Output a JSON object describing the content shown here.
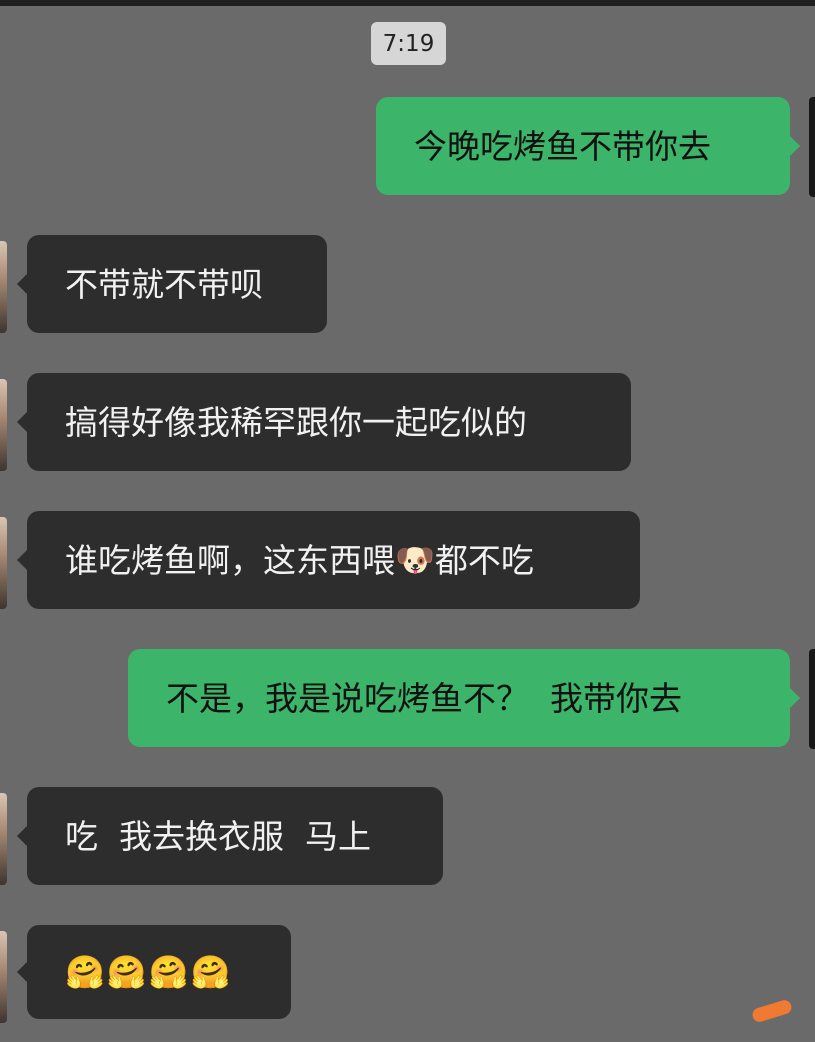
{
  "chat": {
    "time": "7:19",
    "messages": [
      {
        "side": "out",
        "text": "今晚吃烤鱼不带你去"
      },
      {
        "side": "in",
        "text": "不带就不带呗"
      },
      {
        "side": "in",
        "text": "搞得好像我稀罕跟你一起吃似的"
      },
      {
        "side": "in",
        "text_before": "谁吃烤鱼啊，这东西喂",
        "emoji": "🐶",
        "text_after": "都不吃"
      },
      {
        "side": "out",
        "text": "不是，我是说吃烤鱼不？  我带你去"
      },
      {
        "side": "in",
        "text": "吃  我去换衣服  马上"
      },
      {
        "side": "in",
        "emojis": [
          "🤗",
          "🤗",
          "🤗",
          "🤗"
        ]
      }
    ]
  },
  "icons": {
    "dog": "dog-face-icon",
    "hug": "hugging-face-icon"
  },
  "colors": {
    "background": "#6a6a6a",
    "incoming_bubble": "#2d2d2d",
    "outgoing_bubble": "#3cb46a",
    "accent_stroke": "#f07a32"
  }
}
